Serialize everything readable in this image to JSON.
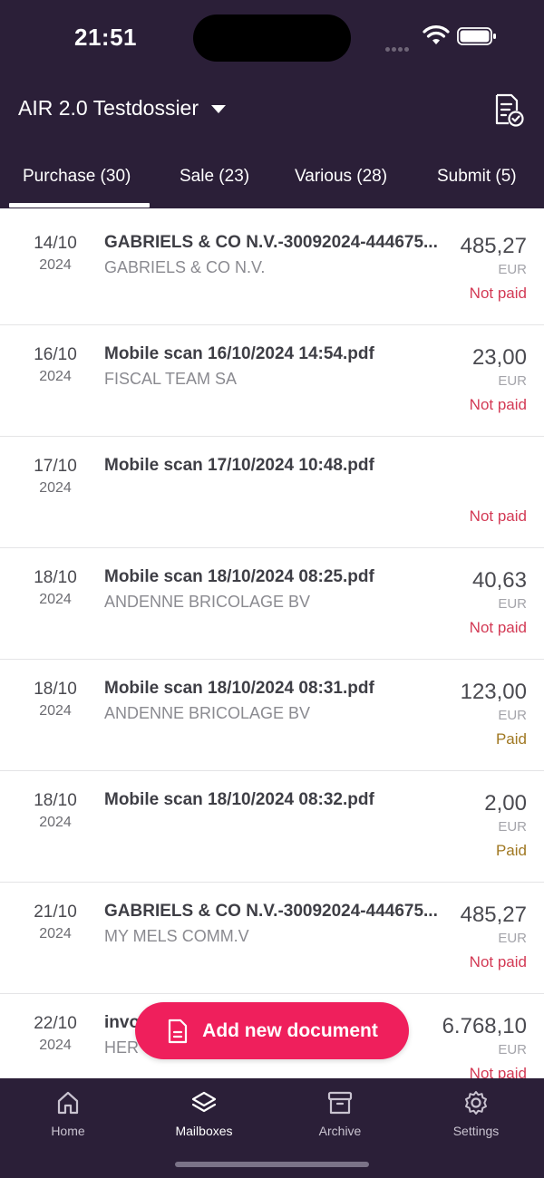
{
  "status_bar": {
    "time": "21:51"
  },
  "header": {
    "dossier_title": "AIR 2.0 Testdossier",
    "icons": {
      "dropdown": "caret-down-icon",
      "action": "document-check-icon"
    }
  },
  "tabs": [
    {
      "label": "Purchase (30)",
      "active": true
    },
    {
      "label": "Sale (23)",
      "active": false
    },
    {
      "label": "Various (28)",
      "active": false
    },
    {
      "label": "Submit (5)",
      "active": false
    }
  ],
  "documents": [
    {
      "day": "14/10",
      "year": "2024",
      "title": "GABRIELS & CO N.V.-30092024-444675...",
      "supplier": "GABRIELS & CO N.V.",
      "amount": "485,27",
      "currency": "EUR",
      "status": "Not paid"
    },
    {
      "day": "16/10",
      "year": "2024",
      "title": "Mobile scan 16/10/2024 14:54.pdf",
      "supplier": "FISCAL TEAM SA",
      "amount": "23,00",
      "currency": "EUR",
      "status": "Not paid"
    },
    {
      "day": "17/10",
      "year": "2024",
      "title": "Mobile scan 17/10/2024 10:48.pdf",
      "supplier": "",
      "amount": "",
      "currency": "",
      "status": "Not paid"
    },
    {
      "day": "18/10",
      "year": "2024",
      "title": "Mobile scan 18/10/2024 08:25.pdf",
      "supplier": "ANDENNE BRICOLAGE BV",
      "amount": "40,63",
      "currency": "EUR",
      "status": "Not paid"
    },
    {
      "day": "18/10",
      "year": "2024",
      "title": "Mobile scan 18/10/2024 08:31.pdf",
      "supplier": "ANDENNE BRICOLAGE BV",
      "amount": "123,00",
      "currency": "EUR",
      "status": "Paid"
    },
    {
      "day": "18/10",
      "year": "2024",
      "title": "Mobile scan 18/10/2024 08:32.pdf",
      "supplier": "",
      "amount": "2,00",
      "currency": "EUR",
      "status": "Paid"
    },
    {
      "day": "21/10",
      "year": "2024",
      "title": "GABRIELS & CO N.V.-30092024-444675...",
      "supplier": "MY MELS COMM.V",
      "amount": "485,27",
      "currency": "EUR",
      "status": "Not paid"
    },
    {
      "day": "22/10",
      "year": "2024",
      "title": "invo",
      "supplier": "HER",
      "amount": "6.768,10",
      "currency": "EUR",
      "status": "Not paid"
    }
  ],
  "fab": {
    "label": "Add new document",
    "icon": "document-icon"
  },
  "bottom_nav": [
    {
      "label": "Home",
      "icon": "home-icon",
      "active": false
    },
    {
      "label": "Mailboxes",
      "icon": "layers-icon",
      "active": true
    },
    {
      "label": "Archive",
      "icon": "archive-icon",
      "active": false
    },
    {
      "label": "Settings",
      "icon": "gear-icon",
      "active": false
    }
  ],
  "colors": {
    "header_bg": "#2b1f38",
    "accent": "#ef1f5c",
    "not_paid": "#d33a55",
    "paid": "#a07822"
  }
}
